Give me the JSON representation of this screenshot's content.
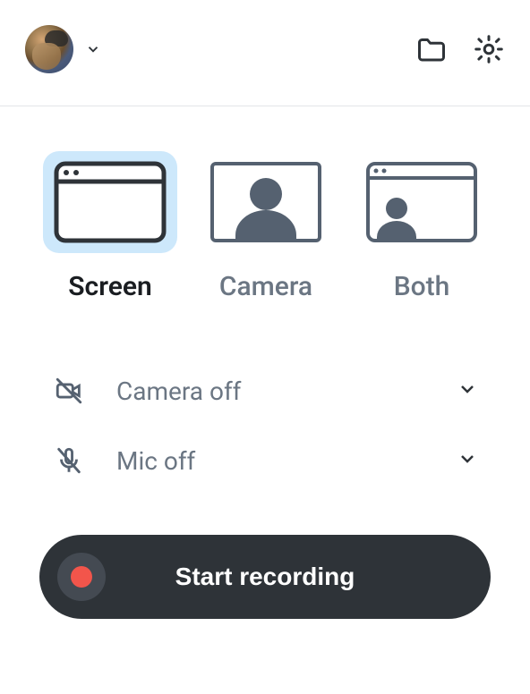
{
  "modes": {
    "screen": {
      "label": "Screen"
    },
    "camera": {
      "label": "Camera"
    },
    "both": {
      "label": "Both"
    }
  },
  "settings": {
    "camera": {
      "label": "Camera off"
    },
    "mic": {
      "label": "Mic off"
    }
  },
  "record": {
    "label": "Start recording"
  }
}
